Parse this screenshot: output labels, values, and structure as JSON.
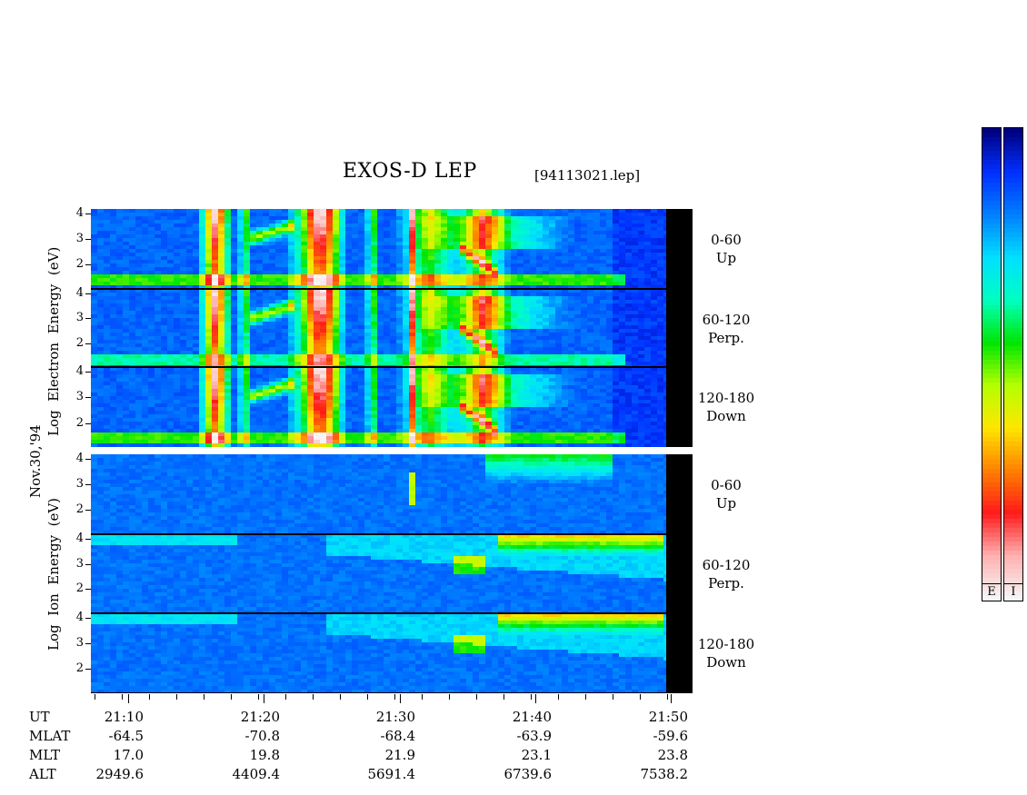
{
  "header": {
    "title": "EXOS-D LEP",
    "filename": "[94113021.lep]"
  },
  "left_labels": {
    "date": "Nov.30,'94",
    "electron_title": [
      "Log",
      "Electron",
      "Energy",
      "(eV)"
    ],
    "ion_title": [
      "Log",
      "Ion",
      "Energy",
      "(eV)"
    ]
  },
  "panels": [
    {
      "angle": "0-60",
      "dir": "Up"
    },
    {
      "angle": "60-120",
      "dir": "Perp."
    },
    {
      "angle": "120-180",
      "dir": "Down"
    },
    {
      "angle": "0-60",
      "dir": "Up"
    },
    {
      "angle": "60-120",
      "dir": "Perp."
    },
    {
      "angle": "120-180",
      "dir": "Down"
    }
  ],
  "y_ticks": [
    "4",
    "3",
    "2"
  ],
  "orbit_table": {
    "rows": [
      {
        "label": "UT",
        "values": [
          "21:10",
          "21:20",
          "21:30",
          "21:40",
          "21:50"
        ]
      },
      {
        "label": "MLAT",
        "values": [
          "-64.5",
          "-70.8",
          "-68.4",
          "-63.9",
          "-59.6"
        ]
      },
      {
        "label": "MLT",
        "values": [
          "17.0",
          "19.8",
          "21.9",
          "23.1",
          "23.8"
        ]
      },
      {
        "label": "ALT",
        "values": [
          "2949.6",
          "4409.4",
          "5691.4",
          "6739.6",
          "7538.2"
        ]
      }
    ]
  },
  "colorbars": [
    {
      "label": "E"
    },
    {
      "label": "I"
    }
  ],
  "chart_data": {
    "type": "heatmap",
    "title": "EXOS-D LEP",
    "xlabel": "UT",
    "x_ticks": [
      "21:10",
      "21:20",
      "21:30",
      "21:40",
      "21:50"
    ],
    "xlim": [
      "21:07",
      "21:51"
    ],
    "ylabel_electron": "Log Electron Energy (eV)",
    "ylabel_ion": "Log Ion Energy (eV)",
    "ylim": [
      1,
      4.1
    ],
    "y_ticks": [
      2,
      3,
      4
    ],
    "panels": [
      "0-60 Up",
      "60-120 Perp.",
      "120-180 Down",
      "0-60 Up",
      "60-120 Perp.",
      "120-180 Down"
    ]
  }
}
